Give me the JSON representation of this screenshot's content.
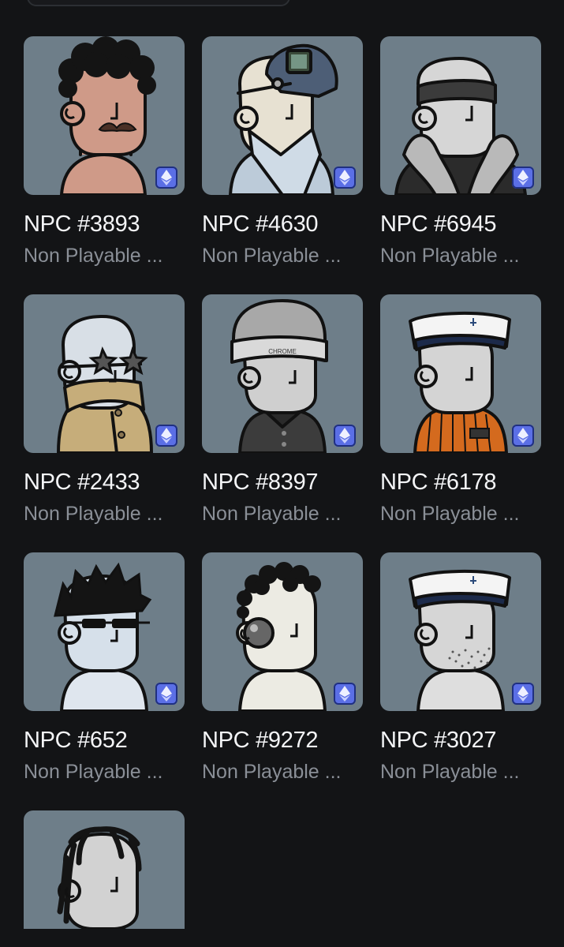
{
  "collection_name": "Non Playable ...",
  "colors": {
    "page_background": "#131416",
    "card_background": "#6e7e89",
    "chain_badge": "#5b6fe6",
    "title_text": "#f4f5f7",
    "subtitle_text": "#8a8f97"
  },
  "chain_icon": "ethereum-icon",
  "items": [
    {
      "name": "NPC #3893",
      "collection": "Non Playable ...",
      "skin": "#cf9a88",
      "headwear": "afro-hair",
      "accessory": "mustache",
      "outfit": "shirtless"
    },
    {
      "name": "NPC #4630",
      "collection": "Non Playable ...",
      "skin": "#e7e1d2",
      "headwear": "welding-mask",
      "accessory": "none",
      "outfit": "puffer-jacket"
    },
    {
      "name": "NPC #6945",
      "collection": "Non Playable ...",
      "skin": "#d6d6d6",
      "headwear": "headband",
      "accessory": "none",
      "outfit": "fur-collar-coat"
    },
    {
      "name": "NPC #2433",
      "collection": "Non Playable ...",
      "skin": "#d8dfe6",
      "headwear": "bald",
      "accessory": "star-glasses",
      "outfit": "tan-coat"
    },
    {
      "name": "NPC #8397",
      "collection": "Non Playable ...",
      "skin": "#cfcfcf",
      "headwear": "chrome-beanie",
      "headwear_text": "CHROME",
      "accessory": "none",
      "outfit": "polo"
    },
    {
      "name": "NPC #6178",
      "collection": "Non Playable ...",
      "skin": "#d4d4d4",
      "headwear": "sailor-hat",
      "accessory": "none",
      "outfit": "striped-orange-jacket"
    },
    {
      "name": "NPC #652",
      "collection": "Non Playable ...",
      "skin": "#d6e0ea",
      "headwear": "messy-hair",
      "accessory": "sunglasses",
      "outfit": "tshirt"
    },
    {
      "name": "NPC #9272",
      "collection": "Non Playable ...",
      "skin": "#ecebe3",
      "headwear": "curly-hair",
      "accessory": "monocle",
      "outfit": "tshirt"
    },
    {
      "name": "NPC #3027",
      "collection": "Non Playable ...",
      "skin": "#d6d6d6",
      "headwear": "sailor-hat",
      "accessory": "stubble",
      "outfit": "tshirt"
    },
    {
      "name": "",
      "collection": "",
      "skin": "#d2d2d2",
      "headwear": "dreadlocks",
      "accessory": "none",
      "outfit": "tshirt",
      "partial": true
    }
  ]
}
